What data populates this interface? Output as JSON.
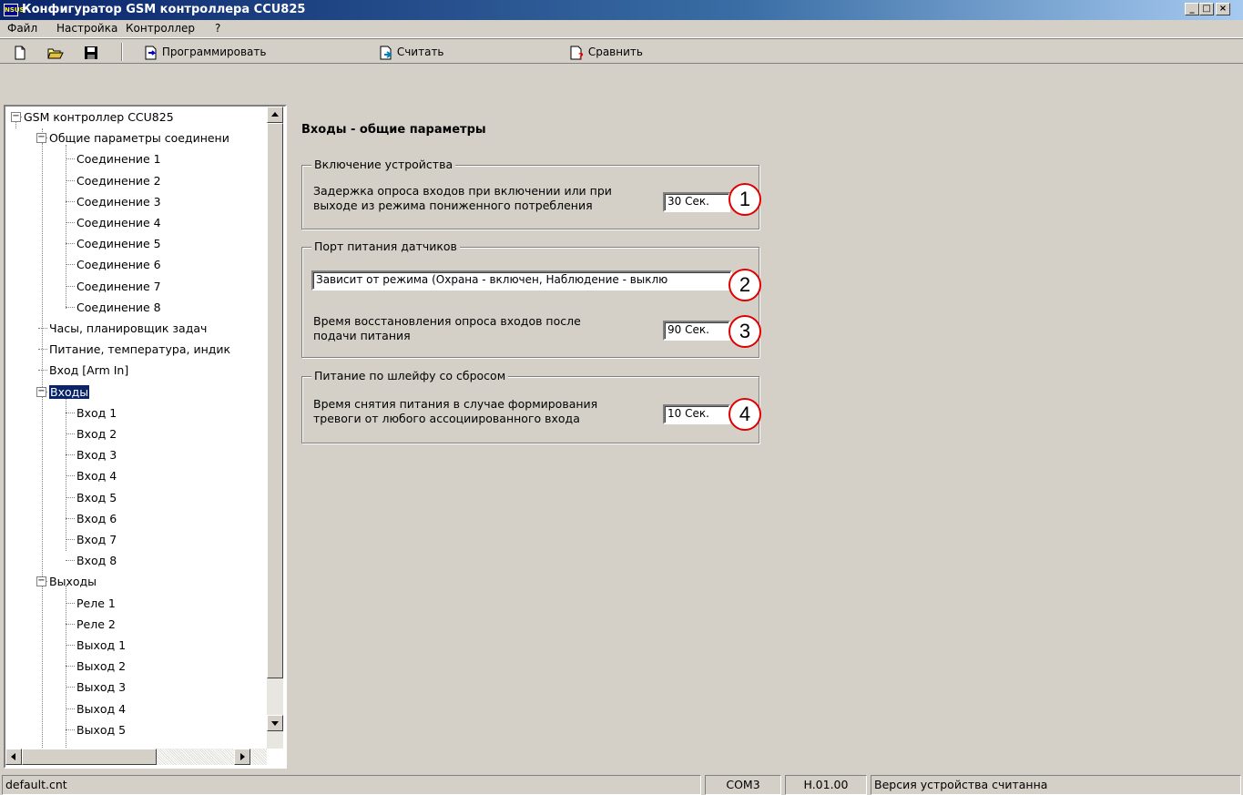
{
  "window": {
    "app_icon_text": "NSUS",
    "title": "Конфигуратор GSM контроллера CCU825",
    "minimize": "_",
    "maximize": "□",
    "close": "×"
  },
  "menu": [
    "Файл",
    "Настройка",
    "Контроллер",
    "?"
  ],
  "toolbar": {
    "program_label": "Программировать",
    "read_label": "Считать",
    "compare_label": "Сравнить"
  },
  "tree": {
    "root": "GSM контроллер CCU825",
    "connections_parent": "Общие параметры соединени",
    "connections": [
      "Соединение 1",
      "Соединение 2",
      "Соединение 3",
      "Соединение 4",
      "Соединение 5",
      "Соединение 6",
      "Соединение 7",
      "Соединение 8"
    ],
    "clock": "Часы, планировщик задач",
    "power": "Питание, температура, индик",
    "arm_input": "Вход [Arm In]",
    "inputs_parent": "Входы",
    "inputs": [
      "Вход 1",
      "Вход 2",
      "Вход 3",
      "Вход 4",
      "Вход 5",
      "Вход 6",
      "Вход 7",
      "Вход 8"
    ],
    "outputs_parent": "Выходы",
    "outputs": [
      "Реле 1",
      "Реле 2",
      "Выход 1",
      "Выход 2",
      "Выход 3",
      "Выход 4",
      "Выход 5"
    ]
  },
  "main": {
    "title": "Входы - общие параметры",
    "group1": {
      "legend": "Включение устройства",
      "label_line1": "Задержка опроса входов при включении или при",
      "label_line2": "выходе из режима пониженного потребления",
      "value": "30 Сек."
    },
    "group2": {
      "legend": "Порт питания датчиков",
      "mode_value": "Зависит от режима (Охрана - включен, Наблюдение - выклю",
      "label_line1": "Время восстановления опроса входов после",
      "label_line2": "подачи питания",
      "value": "90 Сек."
    },
    "group3": {
      "legend": "Питание по шлейфу со сбросом",
      "label_line1": "Время снятия питания в случае формирования",
      "label_line2": "тревоги от любого ассоциированного входа",
      "value": "10 Сек."
    },
    "callouts": [
      "1",
      "2",
      "3",
      "4"
    ]
  },
  "status": {
    "file": "default.cnt",
    "port": "COM3",
    "version": "H.01.00",
    "message": "Версия устройства считанна"
  }
}
